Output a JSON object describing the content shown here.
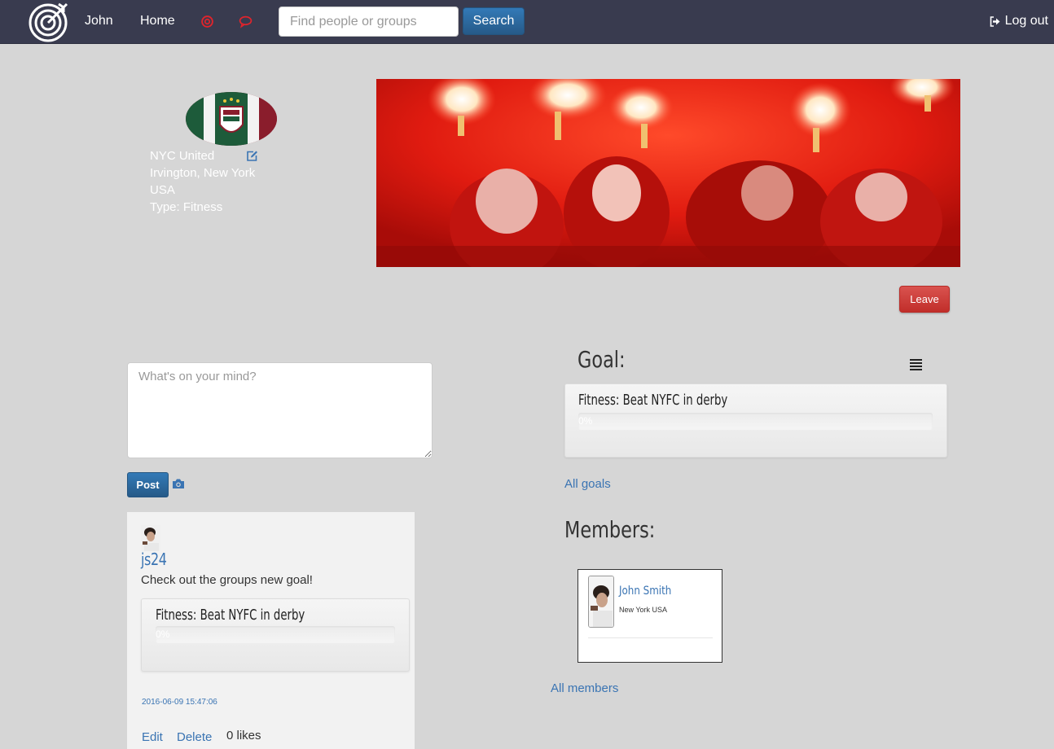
{
  "nav": {
    "user": "John",
    "home": "Home",
    "search_placeholder": "Find people or groups",
    "search_label": "Search",
    "logout": "Log out"
  },
  "group": {
    "name": "NYC United",
    "city": "Irvington, New York",
    "country": "USA",
    "type": "Type: Fitness",
    "leave_label": "Leave"
  },
  "composer": {
    "placeholder": "What's on your mind?",
    "post_label": "Post"
  },
  "feed": [
    {
      "author": "js24",
      "text": "Check out the groups new goal!",
      "goal_title": "Fitness: Beat NYFC in derby",
      "goal_progress": "0%",
      "timestamp": "2016-06-09 15:47:06",
      "edit": "Edit",
      "delete": "Delete",
      "likes": "0 likes"
    }
  ],
  "goals": {
    "heading": "Goal:",
    "items": [
      {
        "title": "Fitness: Beat NYFC in derby",
        "progress": "0%"
      }
    ],
    "all_link": "All goals"
  },
  "members": {
    "heading": "Members:",
    "items": [
      {
        "name": "John Smith",
        "location": "New York USA"
      }
    ],
    "all_link": "All members"
  },
  "colors": {
    "navbar": "#393b4f",
    "background": "#d6d6d6",
    "primary": "#337ab7",
    "danger": "#d9534f",
    "link": "#3a74b3"
  },
  "icons": [
    "target-logo-icon",
    "alert-icon",
    "chat-icon",
    "sign-out-icon",
    "edit-icon",
    "camera-icon",
    "list-icon"
  ]
}
